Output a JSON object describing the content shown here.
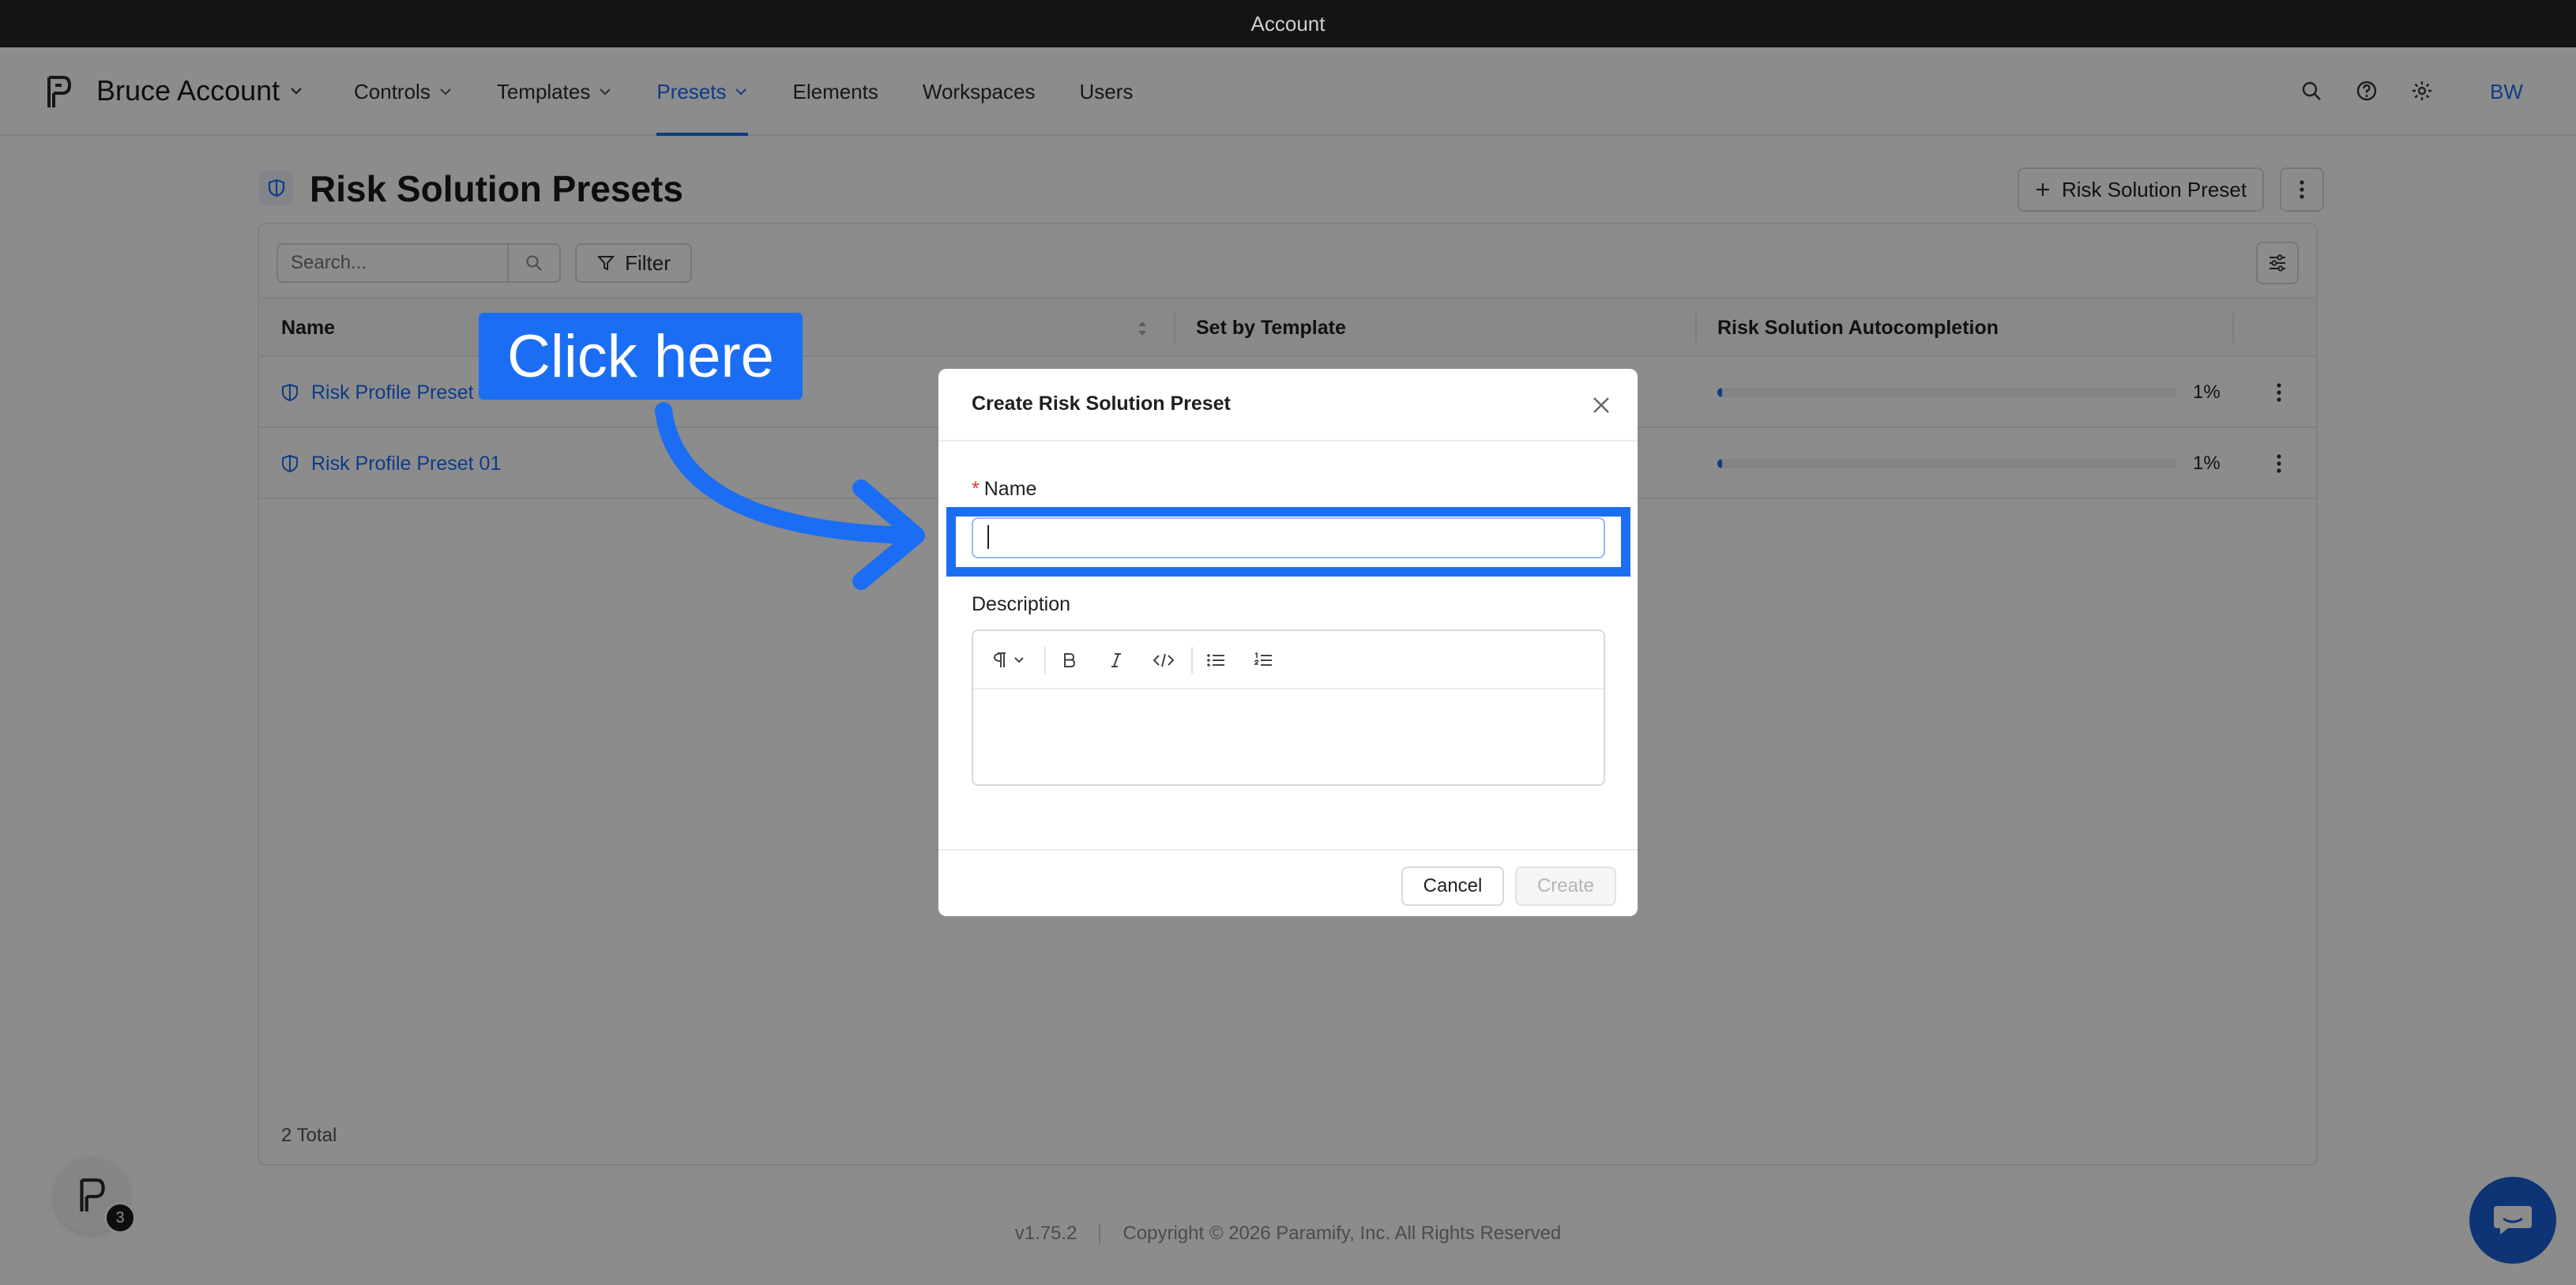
{
  "window": {
    "title": "Account"
  },
  "header": {
    "account_name": "Bruce Account",
    "nav": [
      {
        "label": "Controls",
        "dropdown": true,
        "active": false
      },
      {
        "label": "Templates",
        "dropdown": true,
        "active": false
      },
      {
        "label": "Presets",
        "dropdown": true,
        "active": true
      },
      {
        "label": "Elements",
        "dropdown": false,
        "active": false
      },
      {
        "label": "Workspaces",
        "dropdown": false,
        "active": false
      },
      {
        "label": "Users",
        "dropdown": false,
        "active": false
      }
    ],
    "icons": [
      "search-icon",
      "help-icon",
      "gear-icon"
    ],
    "avatar_initials": "BW"
  },
  "page": {
    "title": "Risk Solution Presets",
    "add_button_label": "Risk Solution Preset",
    "search_placeholder": "Search...",
    "filter_label": "Filter",
    "columns": [
      "Name",
      "Set by Template",
      "Risk Solution Autocompletion"
    ],
    "rows": [
      {
        "name": "Risk Profile Preset 02",
        "autocompletion": "1%",
        "progress": 0.01
      },
      {
        "name": "Risk Profile Preset 01",
        "autocompletion": "1%",
        "progress": 0.01
      }
    ],
    "total": "2 Total"
  },
  "footer": {
    "version": "v1.75.2",
    "copyright": "Copyright © 2026 Paramify, Inc. All Rights Reserved"
  },
  "help_fab": {
    "badge": "3"
  },
  "modal": {
    "title": "Create Risk Solution Preset",
    "name_label": "Name",
    "name_required_mark": "*",
    "name_value": "",
    "description_label": "Description",
    "toolbar": [
      "paragraph-icon",
      "bold-icon",
      "italic-icon",
      "code-icon",
      "bullet-list-icon",
      "numbered-list-icon"
    ],
    "cancel_label": "Cancel",
    "create_label": "Create"
  },
  "annotation": {
    "callout_text": "Click here",
    "color": "#1b6ef3"
  },
  "colors": {
    "accent": "#1b6ef3",
    "titlebar": "#141414",
    "chat_fab": "#1b5fd6",
    "required": "#e03131"
  }
}
